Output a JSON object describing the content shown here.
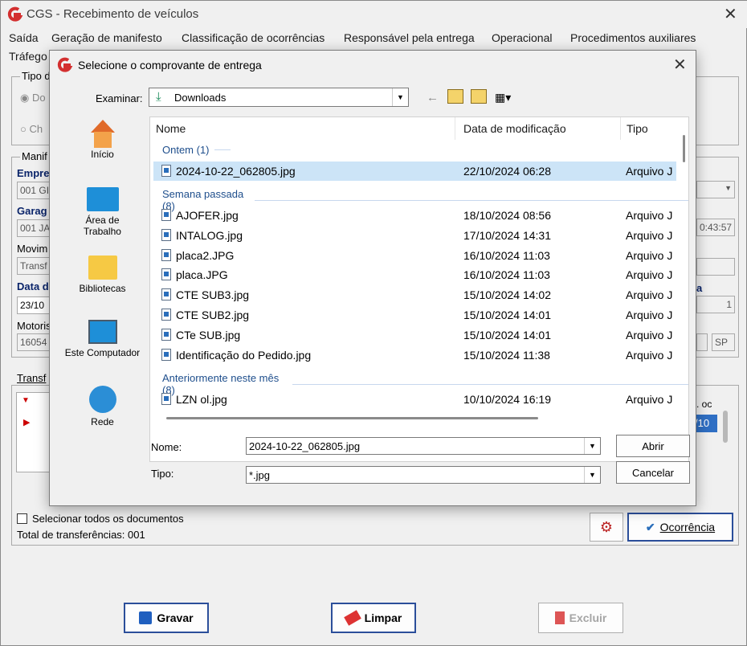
{
  "app": {
    "title": "CGS - Recebimento de veículos",
    "menu": [
      "Saída",
      "Geração de manifesto",
      "Classificação de ocorrências",
      "Responsável pela entrega",
      "Operacional",
      "Procedimentos auxiliares",
      "Tráfego"
    ],
    "tipo_label": "Tipo d",
    "radio1": "Do",
    "radio2": "Ch",
    "manif_label": "Manif",
    "empresa_label": "Empre",
    "empresa_value": "001 GI",
    "garagem_label": "Garag",
    "garagem_value": "001 JA",
    "movim_label": "Movim",
    "movim_value": "Transf",
    "data_label": "Data d",
    "data_value": "23/10",
    "motoris_label": "Motoris",
    "motoris_value": "16054",
    "time_value": "0:43:57",
    "number_a": "a",
    "number_value": "1",
    "uf_value": "SP",
    "transf_tab": "Transf",
    "grid_col_right": ". oc",
    "grid_cell_right": "/10",
    "select_all": "Selecionar todos os documentos",
    "total": "Total de transferências: 001",
    "ocorrencia_btn": "Ocorrência",
    "gravar_btn": "Gravar",
    "limpar_btn": "Limpar",
    "excluir_btn": "Excluir"
  },
  "dialog": {
    "title": "Selecione o comprovante de entrega",
    "examinar_label": "Examinar:",
    "examinar_value": "Downloads",
    "places": [
      "Início",
      "Área de Trabalho",
      "Bibliotecas",
      "Este Computador",
      "Rede"
    ],
    "columns": [
      "Nome",
      "Data de modificação",
      "Tipo"
    ],
    "groups": [
      {
        "label": "Ontem (1)",
        "files": [
          {
            "name": "2024-10-22_062805.jpg",
            "date": "22/10/2024 06:28",
            "type": "Arquivo J",
            "selected": true
          }
        ]
      },
      {
        "label": "Semana passada (8)",
        "files": [
          {
            "name": "AJOFER.jpg",
            "date": "18/10/2024 08:56",
            "type": "Arquivo J"
          },
          {
            "name": "INTALOG.jpg",
            "date": "17/10/2024 14:31",
            "type": "Arquivo J"
          },
          {
            "name": "placa2.JPG",
            "date": "16/10/2024 11:03",
            "type": "Arquivo J"
          },
          {
            "name": "placa.JPG",
            "date": "16/10/2024 11:03",
            "type": "Arquivo J"
          },
          {
            "name": "CTE SUB3.jpg",
            "date": "15/10/2024 14:02",
            "type": "Arquivo J"
          },
          {
            "name": "CTE SUB2.jpg",
            "date": "15/10/2024 14:01",
            "type": "Arquivo J"
          },
          {
            "name": "CTe SUB.jpg",
            "date": "15/10/2024 14:01",
            "type": "Arquivo J"
          },
          {
            "name": "Identificação do Pedido.jpg",
            "date": "15/10/2024 11:38",
            "type": "Arquivo J"
          }
        ]
      },
      {
        "label": "Anteriormente neste mês (8)",
        "files": [
          {
            "name": "LZN ol.jpg",
            "date": "10/10/2024 16:19",
            "type": "Arquivo J"
          }
        ]
      }
    ],
    "nome_label": "Nome:",
    "nome_value": "2024-10-22_062805.jpg",
    "tipo_label": "Tipo:",
    "tipo_value": "*.jpg",
    "abrir": "Abrir",
    "cancelar": "Cancelar"
  },
  "colors": {
    "accent": "#0a246a",
    "selection": "#cce4f7",
    "group": "#1e4e8c",
    "logo": "#d32f2f"
  }
}
